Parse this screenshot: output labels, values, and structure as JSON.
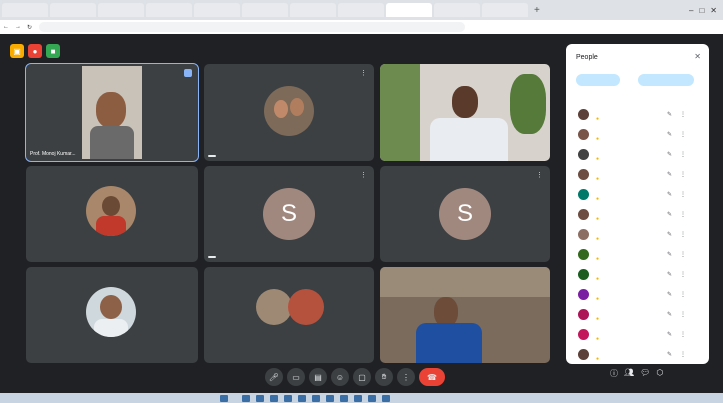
{
  "browser": {
    "tabs": [
      "",
      "",
      "",
      "",
      "",
      "",
      "",
      "",
      "",
      "",
      ""
    ],
    "url": ""
  },
  "colors": {
    "meet_bg": "#202124",
    "tile_bg": "#3c4043",
    "end_call": "#ea4335",
    "accent": "#8ab4f8",
    "avatar_letter_bg": "#a1887f"
  },
  "meeting": {
    "tiles": [
      {
        "name": "Prof. Monoj Kumar...",
        "kind": "video"
      },
      {
        "name": "",
        "kind": "avatar-photo"
      },
      {
        "name": "",
        "kind": "video"
      },
      {
        "name": "",
        "kind": "avatar-photo"
      },
      {
        "name": "",
        "kind": "letter",
        "letter": "S"
      },
      {
        "name": "",
        "kind": "letter",
        "letter": "S"
      },
      {
        "name": "",
        "kind": "avatar-photo"
      },
      {
        "name": "",
        "kind": "avatar-photo"
      },
      {
        "name": "",
        "kind": "video"
      }
    ],
    "bottom_left": ""
  },
  "controls": {
    "icons": [
      "mic-icon",
      "camera-icon",
      "captions-icon",
      "emoji-icon",
      "present-icon",
      "raise-hand-icon",
      "more-icon"
    ],
    "end_call_icon": "phone-hangup-icon",
    "right_icons": [
      "info-icon",
      "people-icon",
      "chat-icon",
      "activities-icon"
    ]
  },
  "people_panel": {
    "title": "People",
    "buttons": [
      "",
      ""
    ],
    "section": "",
    "participants": [
      {
        "name": "",
        "color": "#5d4037"
      },
      {
        "name": "",
        "color": "#795548"
      },
      {
        "name": "",
        "color": "#424242"
      },
      {
        "name": "",
        "color": "#6d4c41"
      },
      {
        "name": "",
        "color": "#00796b"
      },
      {
        "name": "",
        "color": "#6d4c41"
      },
      {
        "name": "",
        "color": "#8d6e63"
      },
      {
        "name": "",
        "color": "#33691e"
      },
      {
        "name": "",
        "color": "#1b5e20"
      },
      {
        "name": "",
        "color": "#7b1fa2"
      },
      {
        "name": "",
        "color": "#ad1457"
      },
      {
        "name": "",
        "color": "#c2185b"
      },
      {
        "name": "",
        "color": "#5d4037"
      }
    ]
  }
}
